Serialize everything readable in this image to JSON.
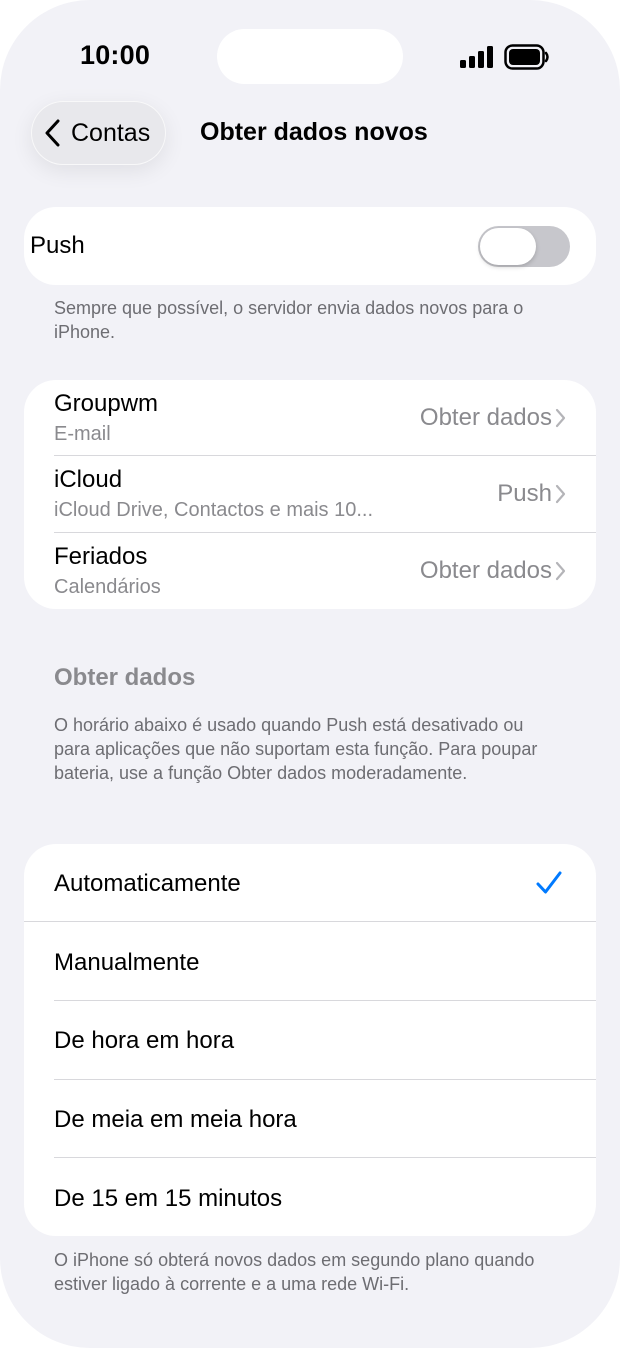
{
  "status_bar": {
    "time": "10:00"
  },
  "nav": {
    "back_label": "Contas",
    "title": "Obter dados novos"
  },
  "push": {
    "label": "Push",
    "enabled": false,
    "footnote": "Sempre que possível, o servidor envia dados novos para o iPhone."
  },
  "accounts": [
    {
      "title": "Groupwm",
      "subtitle": "E-mail",
      "value": "Obter dados"
    },
    {
      "title": "iCloud",
      "subtitle": "iCloud Drive, Contactos e mais 10...",
      "value": "Push"
    },
    {
      "title": "Feriados",
      "subtitle": "Calendários",
      "value": "Obter dados"
    }
  ],
  "fetch_section": {
    "header": "Obter dados",
    "description": "O horário abaixo é usado quando Push está desativado ou para aplicações que não suportam esta função. Para poupar bateria, use a função Obter dados moderadamente."
  },
  "schedule_options": [
    {
      "label": "Automaticamente",
      "selected": true
    },
    {
      "label": "Manualmente",
      "selected": false
    },
    {
      "label": "De hora em hora",
      "selected": false
    },
    {
      "label": "De meia em meia hora",
      "selected": false
    },
    {
      "label": "De 15 em 15 minutos",
      "selected": false
    }
  ],
  "bottom_footnote": "O iPhone só obterá novos dados em segundo plano quando estiver ligado à corrente e a uma rede Wi-Fi.",
  "colors": {
    "accent": "#007aff",
    "background": "#f2f2f7",
    "secondary_text": "#8a8a8e",
    "toggle_off": "#c7c7cc"
  },
  "icons": {
    "back": "chevron-left-icon",
    "row": "chevron-right-icon",
    "selected": "checkmark-icon",
    "signal": "cellular-signal-icon",
    "battery": "battery-icon"
  }
}
